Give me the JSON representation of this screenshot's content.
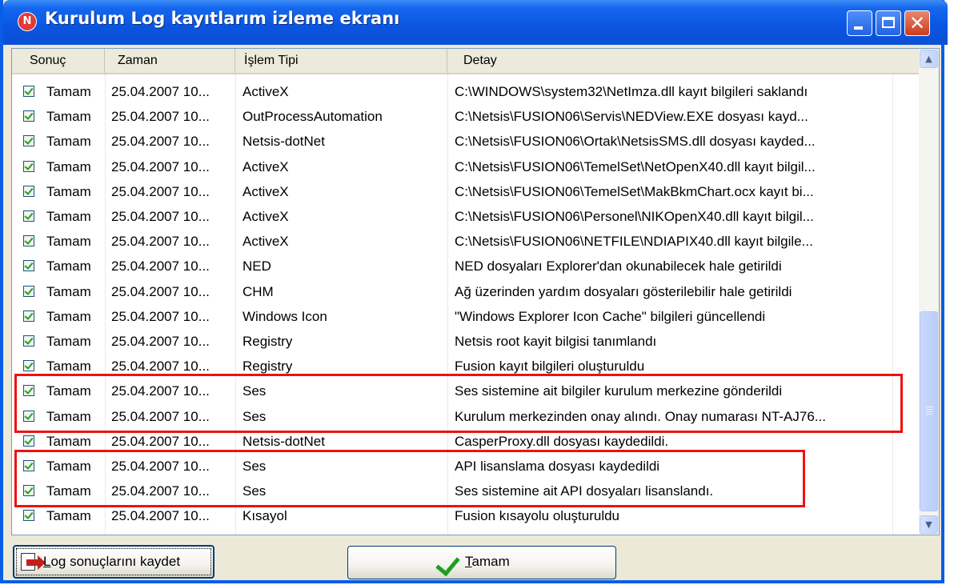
{
  "window": {
    "title": "Kurulum Log kayıtlarım izleme ekranı",
    "app_icon": "N"
  },
  "columns": [
    "Sonuç",
    "Zaman",
    "İşlem Tipi",
    "Detay"
  ],
  "rows": [
    {
      "result": "Tamam",
      "time": "25.04.2007 10...",
      "type": "ActiveX",
      "detail": "C:\\WINDOWS\\system32\\NetImza.dll kayıt bilgileri saklandı"
    },
    {
      "result": "Tamam",
      "time": "25.04.2007 10...",
      "type": "OutProcessAutomation",
      "detail": "C:\\Netsis\\FUSION06\\Servis\\NEDView.EXE dosyası kayd..."
    },
    {
      "result": "Tamam",
      "time": "25.04.2007 10...",
      "type": "Netsis-dotNet",
      "detail": "C:\\Netsis\\FUSION06\\Ortak\\NetsisSMS.dll dosyası kayded..."
    },
    {
      "result": "Tamam",
      "time": "25.04.2007 10...",
      "type": "ActiveX",
      "detail": "C:\\Netsis\\FUSION06\\TemelSet\\NetOpenX40.dll kayıt bilgil..."
    },
    {
      "result": "Tamam",
      "time": "25.04.2007 10...",
      "type": "ActiveX",
      "detail": "C:\\Netsis\\FUSION06\\TemelSet\\MakBkmChart.ocx kayıt bi..."
    },
    {
      "result": "Tamam",
      "time": "25.04.2007 10...",
      "type": "ActiveX",
      "detail": "C:\\Netsis\\FUSION06\\Personel\\NIKOpenX40.dll kayıt bilgil..."
    },
    {
      "result": "Tamam",
      "time": "25.04.2007 10...",
      "type": "ActiveX",
      "detail": "C:\\Netsis\\FUSION06\\NETFILE\\NDIAPIX40.dll kayıt bilgile..."
    },
    {
      "result": "Tamam",
      "time": "25.04.2007 10...",
      "type": "NED",
      "detail": "NED dosyaları Explorer'dan okunabilecek hale getirildi"
    },
    {
      "result": "Tamam",
      "time": "25.04.2007 10...",
      "type": "CHM",
      "detail": "Ağ üzerinden yardım dosyaları gösterilebilir hale getirildi"
    },
    {
      "result": "Tamam",
      "time": "25.04.2007 10...",
      "type": "Windows Icon",
      "detail": "\"Windows Explorer Icon Cache\" bilgileri güncellendi"
    },
    {
      "result": "Tamam",
      "time": "25.04.2007 10...",
      "type": "Registry",
      "detail": "Netsis root kayit bilgisi tanımlandı"
    },
    {
      "result": "Tamam",
      "time": "25.04.2007 10...",
      "type": "Registry",
      "detail": "Fusion kayıt bilgileri oluşturuldu"
    },
    {
      "result": "Tamam",
      "time": "25.04.2007 10...",
      "type": "Ses",
      "detail": "Ses sistemine ait bilgiler kurulum merkezine gönderildi"
    },
    {
      "result": "Tamam",
      "time": "25.04.2007 10...",
      "type": "Ses",
      "detail": "Kurulum merkezinden onay alındı. Onay numarası NT-AJ76..."
    },
    {
      "result": "Tamam",
      "time": "25.04.2007 10...",
      "type": "Netsis-dotNet",
      "detail": "CasperProxy.dll dosyası kaydedildi."
    },
    {
      "result": "Tamam",
      "time": "25.04.2007 10...",
      "type": "Ses",
      "detail": "API lisanslama dosyası kaydedildi"
    },
    {
      "result": "Tamam",
      "time": "25.04.2007 10...",
      "type": "Ses",
      "detail": "Ses sistemine ait API dosyaları lisanslandı."
    },
    {
      "result": "Tamam",
      "time": "25.04.2007 10...",
      "type": "Kısayol",
      "detail": "Fusion kısayolu oluşturuldu"
    }
  ],
  "buttons": {
    "save_key": "L",
    "save_rest": "og sonuçlarını kaydet",
    "ok_key": "T",
    "ok_rest": "amam"
  },
  "icons": {
    "save": "save-log-icon",
    "ok": "checkmark-icon",
    "scroll_up": "scroll-up-icon",
    "scroll_down": "scroll-down-icon"
  },
  "colors": {
    "title_bar": "#0a55e0",
    "highlight": "#ee1111",
    "check": "#21a121"
  }
}
